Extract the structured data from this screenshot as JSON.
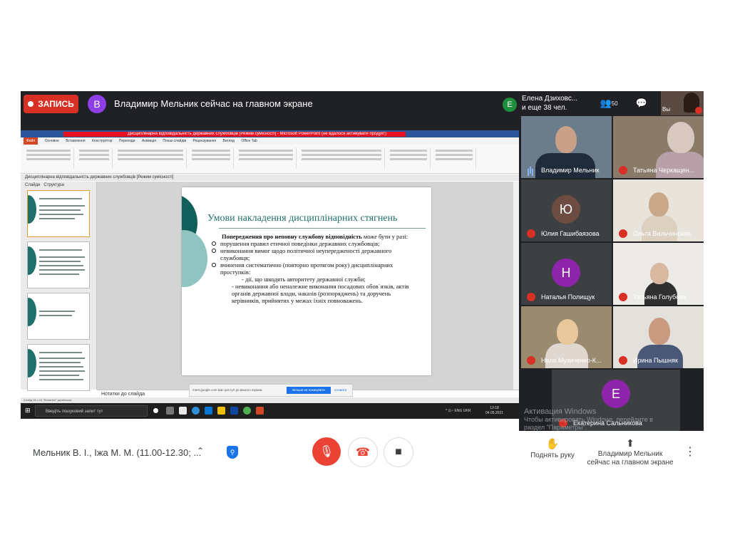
{
  "topbar": {
    "record_label": "ЗАПИСЬ",
    "presenter_initial": "В",
    "presenter_text": "Владимир Мельник сейчас на главном экране",
    "participant_initial": "Е",
    "participant_name": "Елена Дзиховс...",
    "participant_more": "и еще 38 чел.",
    "people_count": "50",
    "self_label": "Вы"
  },
  "ppt": {
    "title_bar": "Дисциплінарна відповідальність державних службовців [Режим сумісності] - Microsoft PowerPoint (не вдалося активувати продукт)",
    "tabs": [
      "Файл",
      "Основне",
      "Вставлення",
      "Конструктор",
      "Переходи",
      "Анімація",
      "Показ слайдів",
      "Рецензування",
      "Вигляд",
      "Office Tab"
    ],
    "doc_tab": "Дисциплінарна відповідальність державних службовців [Режим сумісності]",
    "pane_tabs": [
      "Слайди",
      "Структура"
    ],
    "slide_title": "Умови накладення дисциплінарних стягнень",
    "slide_lead_bold": "Попередження про неповну службову відповідність",
    "slide_lead_rest": " може бути у разі:",
    "bullets": [
      "порушення правил етичної поведінки державних службовців;",
      "невиконання вимог щодо політичної неупередженості державного службовця;",
      "вчинення систематично (повторно протягом року) дисциплінарних проступків:"
    ],
    "sub1": "- дії, що шкодять авторитету державної служби;",
    "sub2": "- невиконання або неналежне виконання посадових обов`язків, актів органів державної влади, наказів (розпоряджень) та доручень керівників, прийнятих у межах їхніх повноважень.",
    "notes": "Нотатки до слайда",
    "notice_text": "meet.google.com має доступ до вашого екрана.",
    "notice_btn": "Більше не показувати",
    "notice_link": "Сховати",
    "status": "Слайд 16 з 24   \"Entwined\"   українська",
    "search": "Введіть пошуковий запит тут",
    "tray": "^ ⊡ ⁿ ENG UKR",
    "clock_time": "13:18",
    "clock_date": "04.05.2021"
  },
  "tiles": [
    {
      "name": "Владимир Мельник",
      "muted": false
    },
    {
      "name": "Татьяна Черкащен...",
      "muted": true
    },
    {
      "name": "Юлия Гашибаязова",
      "muted": true,
      "initial": "Ю",
      "color": "#6d4c41"
    },
    {
      "name": "Ольга Вильчинская",
      "muted": true
    },
    {
      "name": "Наталья Полищук",
      "muted": true,
      "initial": "Н",
      "color": "#8e24aa"
    },
    {
      "name": "Татьяна Голубєва",
      "muted": true
    },
    {
      "name": "Неля Музиченко-К...",
      "muted": true
    },
    {
      "name": "Ирина Пышняк",
      "muted": true
    },
    {
      "name": "Екатерина Сальникова",
      "muted": true,
      "initial": "Е",
      "color": "#8e24aa"
    }
  ],
  "watermark": {
    "title": "Активация Windows",
    "line1": "Чтобы активировать Windows, перейдите в",
    "line2": "раздел \"Параметры\"."
  },
  "bottom": {
    "meeting_title": "Мельник В. І., Іжа М. М. (11.00-12.30; ...",
    "raise_hand": "Поднять руку",
    "present_line1": "Владимир Мельник",
    "present_line2": "сейчас на главном экране"
  },
  "colors": {
    "record": "#d93025",
    "meet_bg": "#202124",
    "accent_teal": "#1f6e6a",
    "mute_red": "#ea4335"
  }
}
